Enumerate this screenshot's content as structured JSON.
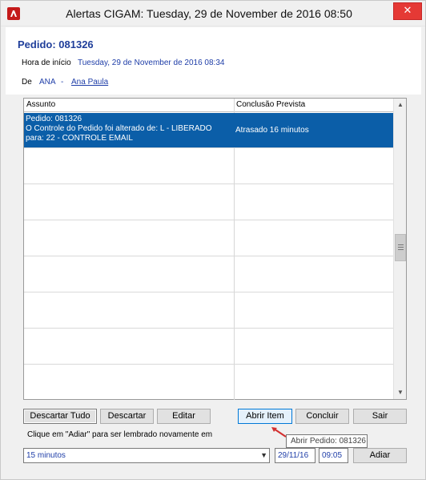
{
  "window": {
    "title": "Alertas CIGAM: Tuesday, 29 de November de 2016 08:50",
    "close_glyph": "✕"
  },
  "alert": {
    "order_title": "Pedido: 081326",
    "start_label": "Hora de início",
    "start_value": "Tuesday, 29 de November de 2016 08:34",
    "from_label": "De",
    "from_user": "ANA",
    "from_separator": "-",
    "from_user_link": "Ana Paula"
  },
  "grid": {
    "columns": [
      "Assunto",
      "Conclusão Prevista"
    ],
    "rows": [
      {
        "subject": "Pedido: 081326\nO Controle do Pedido foi alterado de: L - LIBERADO para: 22 - CONTROLE EMAIL",
        "due": "Atrasado 16 minutos",
        "selected": true
      }
    ],
    "selected_color": "#0b5ea8"
  },
  "buttons": {
    "dismiss_all": "Descartar Tudo",
    "dismiss": "Descartar",
    "edit": "Editar",
    "open_item": "Abrir Item",
    "complete": "Concluir",
    "exit": "Sair",
    "snooze": "Adiar"
  },
  "snooze": {
    "hint": "Clique em \"Adiar\" para ser lembrado novamente em",
    "interval": "15 minutos",
    "date": "29/11/16",
    "time": "09:05"
  },
  "tooltip": {
    "text": "Abrir Pedido: 081326"
  },
  "icons": {
    "app": "cigam-logo-icon",
    "close": "close-icon",
    "dropdown": "chevron-down-icon",
    "scroll_up": "scroll-up-icon",
    "scroll_down": "scroll-down-icon"
  },
  "colors": {
    "accent_link": "#1f3ea8",
    "close_button": "#e53935",
    "app_icon": "#c41a1a"
  }
}
